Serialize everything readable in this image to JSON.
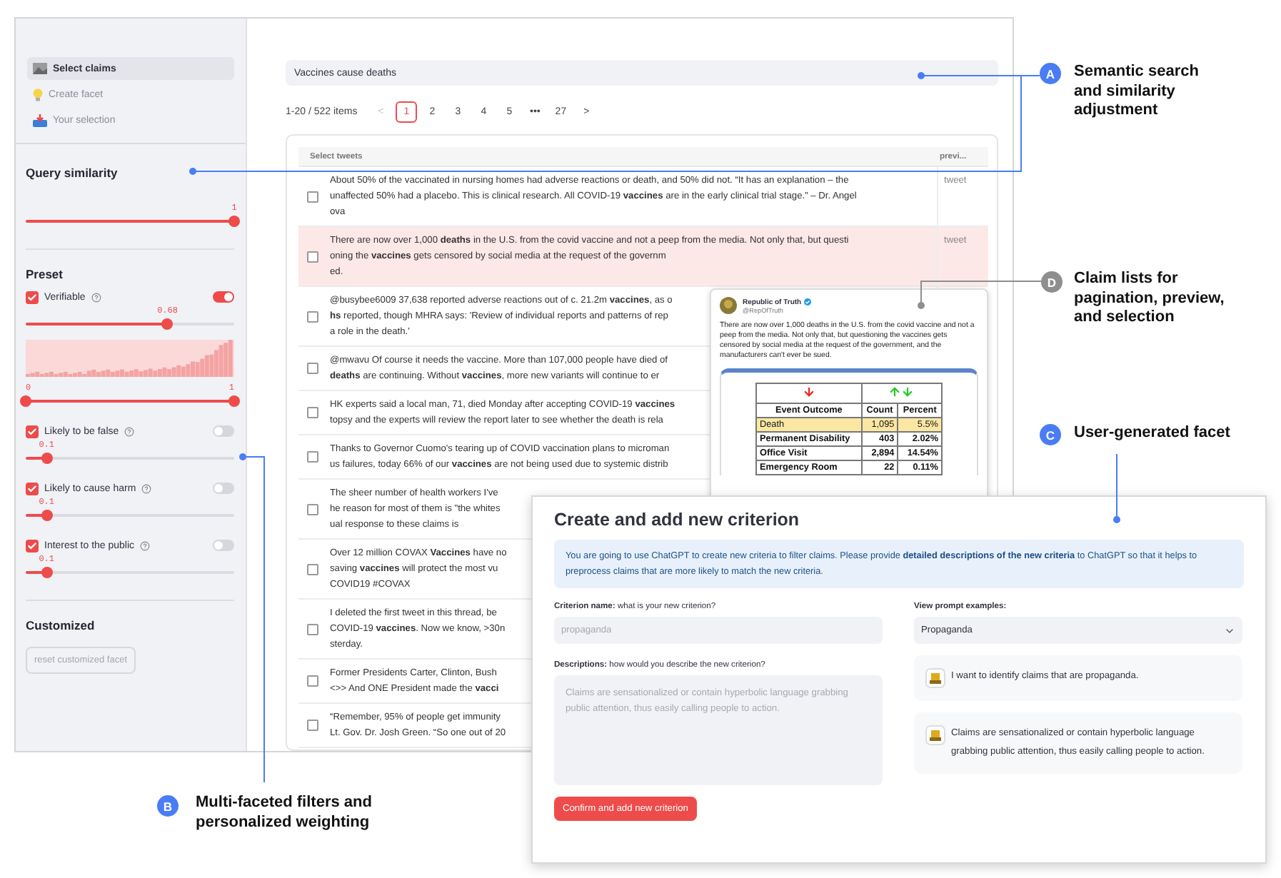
{
  "sidebar": {
    "nav": [
      {
        "label": "Select claims",
        "selected": true
      },
      {
        "label": "Create facet",
        "selected": false
      },
      {
        "label": "Your selection",
        "selected": false
      }
    ],
    "query_similarity": {
      "title": "Query similarity",
      "value": "1",
      "level": 1
    },
    "preset": {
      "title": "Preset",
      "filters": [
        {
          "label": "Verifiable",
          "checked": true,
          "on": true,
          "value": "0.68",
          "level": 0.68,
          "range": {
            "min_label": "0",
            "max_label": "1",
            "level": 1
          }
        },
        {
          "label": "Likely to be false",
          "checked": true,
          "on": false,
          "value": "0.1",
          "level": 0.1
        },
        {
          "label": "Likely to cause harm",
          "checked": true,
          "on": false,
          "value": "0.1",
          "level": 0.1
        },
        {
          "label": "Interest to the public",
          "checked": true,
          "on": false,
          "value": "0.1",
          "level": 0.1
        }
      ]
    },
    "customized": {
      "title": "Customized",
      "button": {
        "label": "reset customized facet",
        "disabled": true
      }
    }
  },
  "search": {
    "value": "Vaccines cause deaths"
  },
  "pagination": {
    "summary": "1-20 / 522 items",
    "prev": {
      "label": "<",
      "disabled": true
    },
    "pages": [
      {
        "label": "1",
        "selected": true
      },
      {
        "label": "2",
        "selected": false
      },
      {
        "label": "3",
        "selected": false
      },
      {
        "label": "4",
        "selected": false
      },
      {
        "label": "5",
        "selected": false
      },
      {
        "label": "•••",
        "selected": false
      },
      {
        "label": "27",
        "selected": false
      }
    ],
    "next": {
      "label": ">",
      "disabled": false
    }
  },
  "table": {
    "columns": [
      "Select tweets",
      "previ..."
    ],
    "rows": [
      {
        "checked": false,
        "highlighted": false,
        "preview": "tweet",
        "lines": [
          "About 50% of the vaccinated in nursing homes had adverse reactions or death, and 50% did not. “It has an explanation – the",
          "unaffected 50% had a placebo. This is clinical research. All COVID-19 **vaccines** are in the early clinical trial stage.” – Dr. Angel",
          "ova"
        ]
      },
      {
        "checked": false,
        "highlighted": true,
        "preview": "tweet",
        "lines": [
          "There are now over 1,000 **deaths** in the U.S. from the covid vaccine and not a peep from the media. Not only that, but questi",
          "oning the **vaccines** gets censored by social media at the request of the governm",
          "ed."
        ]
      },
      {
        "checked": false,
        "highlighted": false,
        "lines": [
          "@busybee6009 37,638 reported adverse reactions out of c. 21.2m **vaccines**, as o",
          "**hs** reported, though MHRA says: 'Review of individual reports and patterns of rep",
          "a role in the death.'"
        ]
      },
      {
        "checked": false,
        "highlighted": false,
        "lines": [
          "@mwavu Of course it needs the vaccine. More than 107,000 people have died of",
          "**deaths** are continuing. Without **vaccines**, more new variants will continue to er"
        ]
      },
      {
        "checked": false,
        "highlighted": false,
        "lines": [
          "HK experts said a local man, 71, died Monday after accepting COVID-19 **vaccines**",
          "topsy and the experts will review the report later to see whether the death is rela"
        ]
      },
      {
        "checked": false,
        "highlighted": false,
        "lines": [
          "Thanks to Governor Cuomo's tearing up of COVID vaccination plans to microman",
          "us failures, today 66% of our **vaccines** are not being used due to systemic distrib"
        ]
      },
      {
        "checked": false,
        "highlighted": false,
        "lines": [
          "The sheer number of health workers I've",
          "he reason for most of them is \"the whites",
          "ual response to these claims is"
        ]
      },
      {
        "checked": false,
        "highlighted": false,
        "lines": [
          "Over 12 million COVAX **Vaccines** have no",
          "saving **vaccines** will protect the most vu",
          "COVID19 #COVAX"
        ]
      },
      {
        "checked": false,
        "highlighted": false,
        "lines": [
          "I deleted the first tweet in this thread, be",
          "COVID-19 **vaccines**. Now we know, >30n",
          "sterday."
        ]
      },
      {
        "checked": false,
        "highlighted": false,
        "lines": [
          "Former Presidents Carter, Clinton, Bush",
          "<>> And ONE President made the **vacci**"
        ]
      },
      {
        "checked": false,
        "highlighted": false,
        "lines": [
          "“Remember, 95% of people get immunity",
          "Lt. Gov. Dr. Josh Green. “So one out of 20"
        ]
      }
    ]
  },
  "tweet_preview": {
    "name": "Republic of Truth",
    "handle": "@RepOfTruth",
    "verified": true,
    "text": "There are now over 1,000 deaths in the U.S. from the covid vaccine and not a peep from the media. Not only that, but questioning the vaccines gets censored by social media at the request of the government, and the manufacturers can't ever be sued.",
    "image_table": {
      "columns": [
        "Event Outcome",
        "Count",
        "Percent"
      ],
      "rows": [
        {
          "cells": [
            "Death",
            "1,095",
            "5.5%"
          ],
          "highlighted": true
        },
        {
          "cells": [
            "Permanent Disability",
            "403",
            "2.02%"
          ],
          "highlighted": false
        },
        {
          "cells": [
            "Office Visit",
            "2,894",
            "14.54%"
          ],
          "highlighted": false
        },
        {
          "cells": [
            "Emergency Room",
            "22",
            "0.11%"
          ],
          "highlighted": false
        }
      ]
    }
  },
  "dialog": {
    "title": "Create and add new criterion",
    "info": "You are going to use ChatGPT to create new criteria to filter claims. Please provide **detailed descriptions of the new criteria** to ChatGPT so that it helps to preprocess claims that are more likely to match the new criteria.",
    "name_label": "**Criterion name:** what is your new criterion?",
    "name_placeholder": "propaganda",
    "description_label": "**Descriptions:** how would you describe the new criterion?",
    "description_placeholder": "Claims are sensationalized or contain hyperbolic language grabbing public attention, thus easily calling people to action.",
    "confirm_button": "Confirm and add new criterion",
    "examples_label": "View prompt examples:",
    "examples_select": "Propaganda",
    "examples": [
      "I want to identify claims that are propaganda.",
      "Claims are sensationalized or contain hyperbolic language grabbing public attention, thus easily calling people to action."
    ]
  },
  "callouts": [
    {
      "letter": "A",
      "text": "Semantic search and similarity adjustment",
      "color": "#4a7cf5"
    },
    {
      "letter": "D",
      "text": "Claim lists for pagination, preview, and selection",
      "color": "#8e8e8e"
    },
    {
      "letter": "C",
      "text": "User-generated facet",
      "color": "#4a7cf5"
    },
    {
      "letter": "B",
      "text": "Multi-faceted filters and personalized weighting",
      "color": "#4a7cf5"
    }
  ]
}
